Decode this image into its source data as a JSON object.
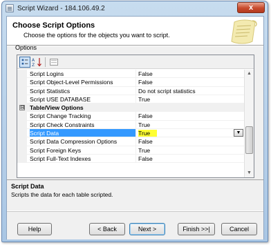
{
  "window": {
    "title": "Script Wizard - 184.106.49.2",
    "close_glyph": "x"
  },
  "header": {
    "title": "Choose Script Options",
    "subtitle": "Choose the options for the objects you want to script."
  },
  "options_label": "Options",
  "toolbar": {
    "categorized_icon": "categorized-icon",
    "alphabetical_icon": "alphabetical-sort-icon",
    "property_pages_icon": "property-pages-icon"
  },
  "grid": {
    "rows": [
      {
        "name": "Script Logins",
        "value": "False"
      },
      {
        "name": "Script Object-Level Permissions",
        "value": "False"
      },
      {
        "name": "Script Statistics",
        "value": "Do not script statistics"
      },
      {
        "name": "Script USE DATABASE",
        "value": "True"
      },
      {
        "name": "Table/View Options",
        "category": true,
        "expander": "⊟"
      },
      {
        "name": "Script Change Tracking",
        "value": "False"
      },
      {
        "name": "Script Check Constraints",
        "value": "True"
      },
      {
        "name": "Script Data",
        "value": "True",
        "selected": true
      },
      {
        "name": "Script Data Compression Options",
        "value": "False"
      },
      {
        "name": "Script Foreign Keys",
        "value": "True"
      },
      {
        "name": "Script Full-Text Indexes",
        "value": "False"
      }
    ]
  },
  "description": {
    "title": "Script Data",
    "text": "Scripts the data for each table scripted."
  },
  "buttons": {
    "help": "Help",
    "back": "< Back",
    "next": "Next >",
    "finish": "Finish >>|",
    "cancel": "Cancel"
  },
  "colors": {
    "selection": "#3399ff",
    "highlight": "#ffff33",
    "title_bar": "#b8d1ea",
    "close": "#c84a2c"
  }
}
